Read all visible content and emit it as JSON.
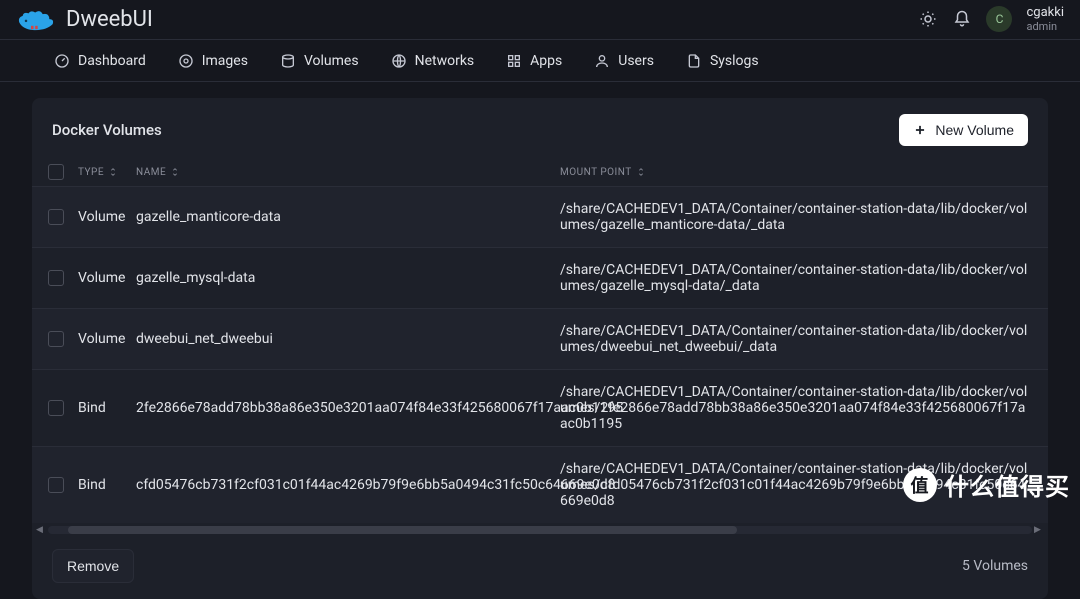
{
  "brand": "DweebUI",
  "user": {
    "initial": "C",
    "name": "cgakki",
    "role": "admin"
  },
  "nav": [
    {
      "id": "dashboard",
      "label": "Dashboard"
    },
    {
      "id": "images",
      "label": "Images"
    },
    {
      "id": "volumes",
      "label": "Volumes"
    },
    {
      "id": "networks",
      "label": "Networks"
    },
    {
      "id": "apps",
      "label": "Apps"
    },
    {
      "id": "users",
      "label": "Users"
    },
    {
      "id": "syslogs",
      "label": "Syslogs"
    }
  ],
  "card": {
    "title": "Docker Volumes",
    "new_button": "New Volume",
    "remove_button": "Remove",
    "count_label": "5 Volumes"
  },
  "columns": {
    "type": "TYPE",
    "name": "NAME",
    "mount": "MOUNT POINT"
  },
  "rows": [
    {
      "type": "Volume",
      "name": "gazelle_manticore-data",
      "mount": "/share/CACHEDEV1_DATA/Container/container-station-data/lib/docker/volumes/gazelle_manticore-data/_data"
    },
    {
      "type": "Volume",
      "name": "gazelle_mysql-data",
      "mount": "/share/CACHEDEV1_DATA/Container/container-station-data/lib/docker/volumes/gazelle_mysql-data/_data"
    },
    {
      "type": "Volume",
      "name": "dweebui_net_dweebui",
      "mount": "/share/CACHEDEV1_DATA/Container/container-station-data/lib/docker/volumes/dweebui_net_dweebui/_data"
    },
    {
      "type": "Bind",
      "name": "2fe2866e78add78bb38a86e350e3201aa074f84e33f425680067f17aac0b1195",
      "mount": "/share/CACHEDEV1_DATA/Container/container-station-data/lib/docker/volumes/2fe2866e78add78bb38a86e350e3201aa074f84e33f425680067f17aac0b1195"
    },
    {
      "type": "Bind",
      "name": "cfd05476cb731f2cf031c01f44ac4269b79f9e6bb5a0494c31fc50c64669e0d8",
      "mount": "/share/CACHEDEV1_DATA/Container/container-station-data/lib/docker/volumes/cfd05476cb731f2cf031c01f44ac4269b79f9e6bb5a0494c31fc50c64669e0d8"
    }
  ],
  "watermark": {
    "symbol": "值",
    "text": "什么值得买"
  }
}
